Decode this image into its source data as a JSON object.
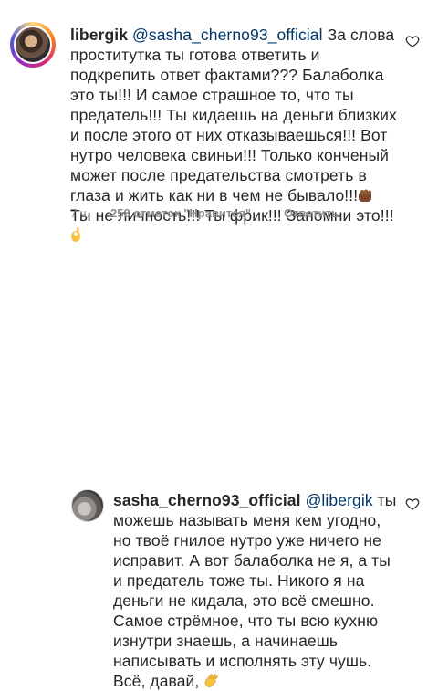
{
  "comment1": {
    "username": "libergik",
    "mention": "@sasha_cherno93_official",
    "text": " За слова проститутка ты готова ответить и подкрепить ответ фактами??? Балаболка это ты!!! И самое страшное то, что ты предатель!!! Ты кидаешь на деньги близких и после этого от них отказываешься!!! Вот нутро человека свиньи!!! Только конченый может после предательства смотреть в глаза и жить как ни в чем не бывало!!!",
    "text_after_fist": " Ты не личность!!! Ты фрик!!! Запомни это!!!",
    "time": "7 ч.",
    "likes": "258 отметок \"Нравится\"",
    "reply": "Ответить",
    "emoji1": "fist-emoji",
    "emoji2": "ok-hand-emoji"
  },
  "comment2": {
    "username": "sasha_cherno93_official",
    "mention": "@libergik",
    "text": " ты можешь называть меня кем угодно, но твоё гнилое нутро уже ничего не исправит. А вот балаболка не я, а ты и предатель тоже ты. Никого я на деньги не кидала, это всё смешно. Самое стрёмное, что ты всю кухню изнутри знаешь, а начинаешь написывать и исполнять эту чушь. Всё, давай,",
    "emoji": "waving-hand-emoji"
  },
  "icons": {
    "like": "heart-outline-icon"
  },
  "colors": {
    "text": "#262626",
    "mention": "#00376b",
    "meta": "#8e8e8e"
  }
}
